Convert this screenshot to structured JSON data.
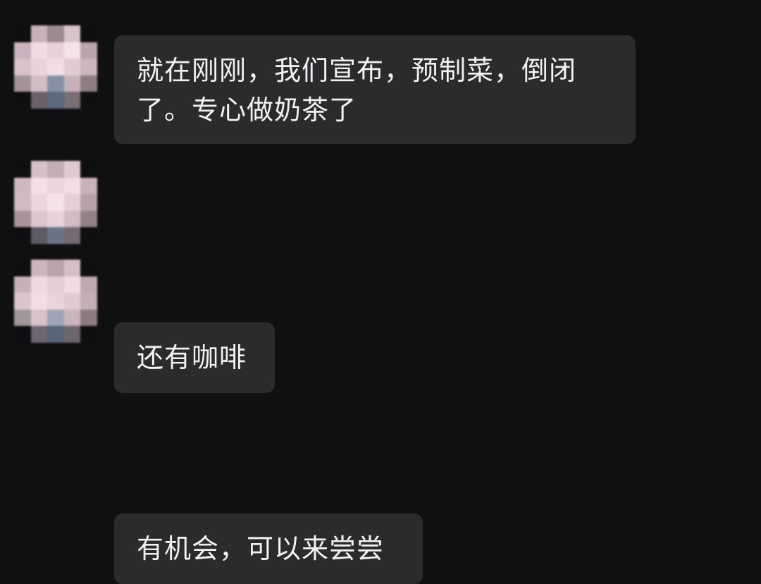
{
  "messages": [
    {
      "text": "就在刚刚，我们宣布，预制菜，倒闭了。专心做奶茶了"
    },
    {
      "text": "还有咖啡"
    },
    {
      "text": "有机会，可以来尝尝"
    }
  ],
  "colors": {
    "background": "#100f11",
    "bubble": "#2b2b2e",
    "text": "#f2f2f2"
  }
}
